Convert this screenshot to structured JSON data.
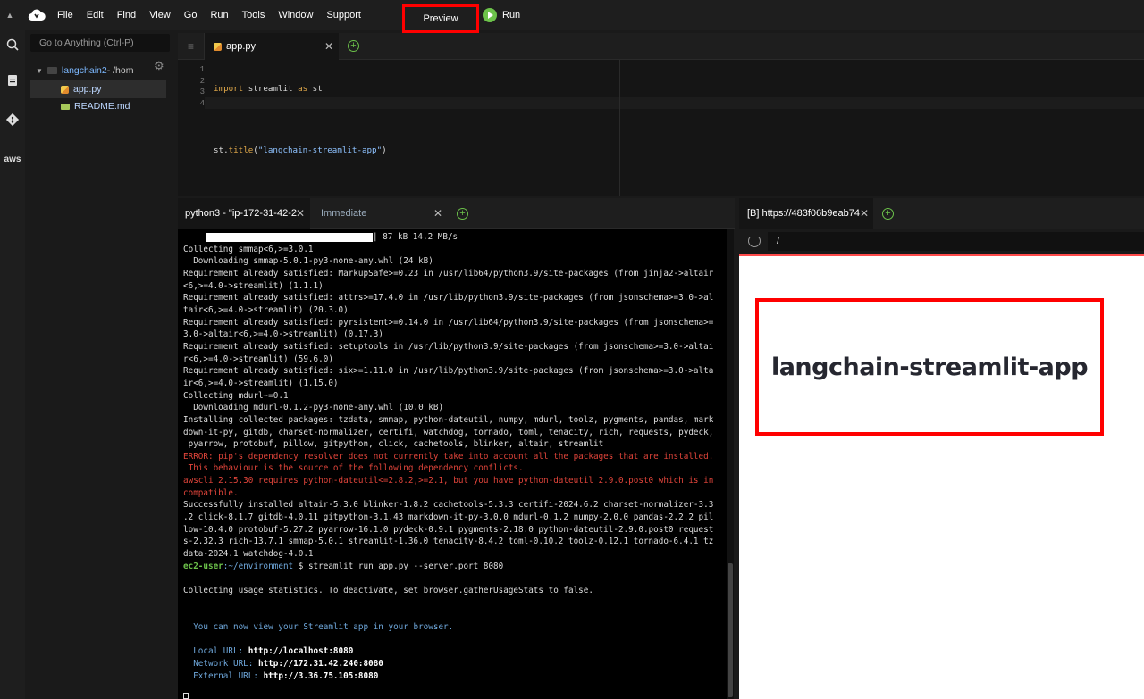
{
  "menubar": {
    "items": [
      "File",
      "Edit",
      "Find",
      "View",
      "Go",
      "Run",
      "Tools",
      "Window",
      "Support"
    ],
    "preview_label": "Preview",
    "run_label": "Run"
  },
  "sidebar": {
    "goto_placeholder": "Go to Anything (Ctrl-P)",
    "root_label": "langchain2",
    "root_suffix": " - /hom",
    "files": [
      "app.py",
      "README.md"
    ]
  },
  "editor": {
    "tab_label": "app.py",
    "line_numbers": [
      "1",
      "2",
      "3",
      "4"
    ],
    "code_import_kw": "import",
    "code_import_rest": " streamlit ",
    "code_as_kw": "as",
    "code_as_rest": " st",
    "code_st": "st.",
    "code_title_fn": "title",
    "code_paren_open": "(",
    "code_title_str": "\"langchain-streamlit-app\"",
    "code_paren_close": ")"
  },
  "terminal": {
    "tab_active": "python3 - \"ip-172-31-42-2",
    "tab_inactive": "Immediate",
    "progress_text": "| 87 kB 14.2 MB/s",
    "lines_normal_1": "Collecting smmap<6,>=3.0.1\n  Downloading smmap-5.0.1-py3-none-any.whl (24 kB)\nRequirement already satisfied: MarkupSafe>=0.23 in /usr/lib64/python3.9/site-packages (from jinja2->altair\n<6,>=4.0->streamlit) (1.1.1)\nRequirement already satisfied: attrs>=17.4.0 in /usr/lib/python3.9/site-packages (from jsonschema>=3.0->al\ntair<6,>=4.0->streamlit) (20.3.0)\nRequirement already satisfied: pyrsistent>=0.14.0 in /usr/lib64/python3.9/site-packages (from jsonschema>=\n3.0->altair<6,>=4.0->streamlit) (0.17.3)\nRequirement already satisfied: setuptools in /usr/lib/python3.9/site-packages (from jsonschema>=3.0->altai\nr<6,>=4.0->streamlit) (59.6.0)\nRequirement already satisfied: six>=1.11.0 in /usr/lib/python3.9/site-packages (from jsonschema>=3.0->alta\nir<6,>=4.0->streamlit) (1.15.0)\nCollecting mdurl~=0.1\n  Downloading mdurl-0.1.2-py3-none-any.whl (10.0 kB)\nInstalling collected packages: tzdata, smmap, python-dateutil, numpy, mdurl, toolz, pygments, pandas, mark\ndown-it-py, gitdb, charset-normalizer, certifi, watchdog, tornado, toml, tenacity, rich, requests, pydeck,\n pyarrow, protobuf, pillow, gitpython, click, cachetools, blinker, altair, streamlit",
    "lines_error": "ERROR: pip's dependency resolver does not currently take into account all the packages that are installed.\n This behaviour is the source of the following dependency conflicts.\nawscli 2.15.30 requires python-dateutil<=2.8.2,>=2.1, but you have python-dateutil 2.9.0.post0 which is in\ncompatible.",
    "lines_normal_2": "Successfully installed altair-5.3.0 blinker-1.8.2 cachetools-5.3.3 certifi-2024.6.2 charset-normalizer-3.3\n.2 click-8.1.7 gitdb-4.0.11 gitpython-3.1.43 markdown-it-py-3.0.0 mdurl-0.1.2 numpy-2.0.0 pandas-2.2.2 pil\nlow-10.4.0 protobuf-5.27.2 pyarrow-16.1.0 pydeck-0.9.1 pygments-2.18.0 python-dateutil-2.9.0.post0 request\ns-2.32.3 rich-13.7.1 smmap-5.0.1 streamlit-1.36.0 tenacity-8.4.2 toml-0.10.2 toolz-0.12.1 tornado-6.4.1 tz\ndata-2024.1 watchdog-4.0.1",
    "prompt_user": "ec2-user",
    "prompt_path": ":~/environment",
    "prompt_cmd": " $ streamlit run app.py --server.port 8080",
    "usage_stats": "Collecting usage statistics. To deactivate, set browser.gatherUsageStats to false.",
    "view_msg": "  You can now view your Streamlit app in your browser.",
    "local_label": "  Local URL: ",
    "local_url": "http://localhost:8080",
    "network_label": "  Network URL: ",
    "network_url": "http://172.31.42.240:8080",
    "external_label": "  External URL: ",
    "external_url": "http://3.36.75.105:8080"
  },
  "browser": {
    "tab_label": "[B] https://483f06b9eab74",
    "url": "/",
    "app_title": "langchain-streamlit-app"
  },
  "colors": {
    "highlight_box": "#ff0000",
    "run_green": "#6cc24a",
    "error_red": "#e0443a"
  }
}
